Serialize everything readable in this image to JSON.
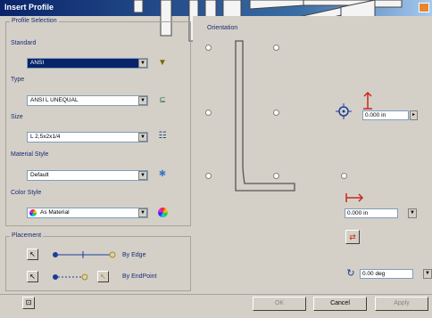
{
  "window": {
    "title": "Insert Profile"
  },
  "profile_selection": {
    "group_label": "Profile Selection",
    "standard": {
      "label": "Standard",
      "value": "ANSI"
    },
    "type": {
      "label": "Type",
      "value": "ANSI L UNEQUAL"
    },
    "size": {
      "label": "Size",
      "value": "L 2,5x2x1/4"
    },
    "material_style": {
      "label": "Material Style",
      "value": "Default"
    },
    "color_style": {
      "label": "Color Style",
      "value": "As Material"
    }
  },
  "placement": {
    "group_label": "Placement",
    "by_edge_label": "By Edge",
    "by_endpoint_label": "By EndPoint"
  },
  "preview": {
    "group_label": "Orientation",
    "offset_y_value": "0.000 in",
    "offset_x_value": "0.000 in",
    "angle_value": "0.00 deg"
  },
  "buttons": {
    "ok": "OK",
    "cancel": "Cancel",
    "apply": "Apply"
  },
  "colors": {
    "title_bar": "#0a246a",
    "dialog_bg": "#d4d0c8",
    "selection": "#0a246a",
    "accent_red": "#c8281e"
  }
}
